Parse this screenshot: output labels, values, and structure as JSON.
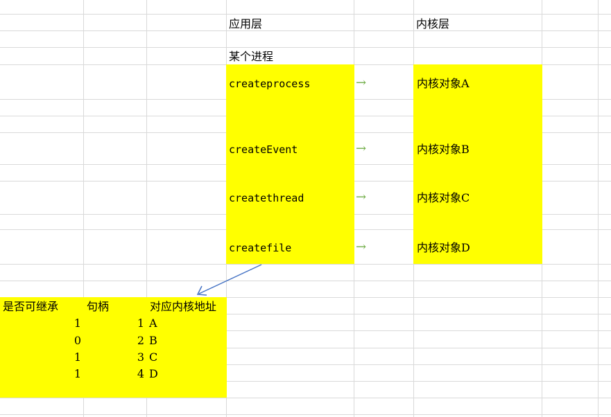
{
  "sheet": {
    "header_app": "应用层",
    "header_kernel": "内核层",
    "process_label": "某个进程",
    "calls": [
      {
        "call": "createprocess",
        "arrow": "→",
        "object": "内核对象A"
      },
      {
        "call": "createEvent",
        "arrow": "→",
        "object": "内核对象B"
      },
      {
        "call": "createthread",
        "arrow": "→",
        "object": "内核对象C"
      },
      {
        "call": "createfile",
        "arrow": "→",
        "object": "内核对象D"
      }
    ],
    "table": {
      "headers": [
        "是否可继承",
        "句柄",
        "对应内核地址"
      ],
      "rows": [
        {
          "inherit": "1",
          "handle": "1",
          "addr": "A"
        },
        {
          "inherit": "0",
          "handle": "2",
          "addr": "B"
        },
        {
          "inherit": "1",
          "handle": "3",
          "addr": "C"
        },
        {
          "inherit": "1",
          "handle": "4",
          "addr": "D"
        }
      ]
    },
    "colors": {
      "highlight": "#ffff00",
      "arrow_green": "#70ad47",
      "connector_blue": "#4472c4",
      "grid": "#d9d9d9"
    }
  }
}
